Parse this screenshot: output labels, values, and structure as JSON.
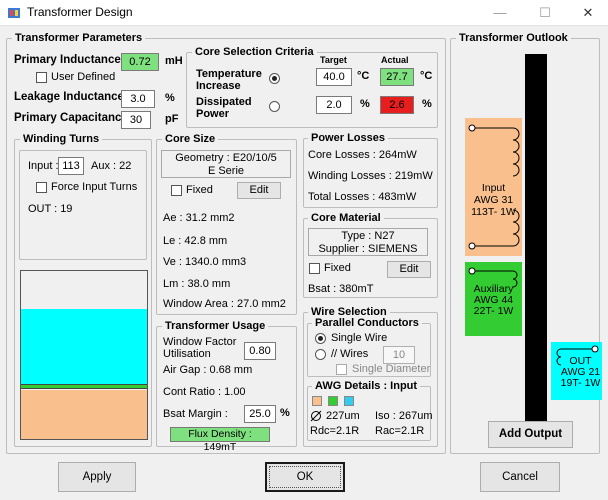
{
  "window": {
    "title": "Transformer Design",
    "min": "—",
    "max": "☐",
    "close": "✕"
  },
  "params": {
    "title": "Transformer Parameters",
    "primary_inductance_label": "Primary Inductance",
    "primary_inductance_value": "0.72",
    "primary_inductance_unit": "mH",
    "user_defined_label": "User Defined",
    "leakage_inductance_label": "Leakage Inductance",
    "leakage_inductance_value": "3.0",
    "leakage_inductance_unit": "%",
    "primary_capacitance_label": "Primary Capacitance",
    "primary_capacitance_value": "30",
    "primary_capacitance_unit": "pF"
  },
  "criteria": {
    "title": "Core Selection Criteria",
    "target_header": "Target",
    "actual_header": "Actual",
    "temp_label_1": "Temperature",
    "temp_label_2": "Increase",
    "temp_target": "40.0",
    "temp_actual": "27.7",
    "temp_unit": "°C",
    "power_label_1": "Dissipated",
    "power_label_2": "Power",
    "power_target": "2.0",
    "power_actual": "2.6",
    "power_unit": "%"
  },
  "winding": {
    "title": "Winding Turns",
    "input_label": "Input :",
    "input_value": "113",
    "aux_label": "Aux : 22",
    "force_label": "Force Input Turns",
    "out_label": "OUT : 19",
    "window_fill": {
      "cyan": "#00ffff",
      "green": "#33cc33",
      "orange": "#f9c08e"
    }
  },
  "core_size": {
    "title": "Core Size",
    "geometry_line1": "Geometry : E20/10/5",
    "geometry_line2": "E Serie",
    "fixed_label": "Fixed",
    "edit_label": "Edit",
    "ae": "Ae : 31.2 mm2",
    "le": "Le : 42.8 mm",
    "ve": "Ve : 1340.0 mm3",
    "lm": "Lm : 38.0 mm",
    "window_area": "Window Area : 27.0 mm2"
  },
  "usage": {
    "title": "Transformer Usage",
    "wfu_label_1": "Window Factor",
    "wfu_label_2": "Utilisation",
    "wfu_value": "0.80",
    "air_gap": "Air Gap : 0.68 mm",
    "cont_ratio": "Cont Ratio : 1.00",
    "bsat_margin_label": "Bsat Margin :",
    "bsat_margin_value": "25.0",
    "bsat_margin_unit": "%",
    "flux_density": "Flux Density : 149mT"
  },
  "losses": {
    "title": "Power Losses",
    "core": "Core Losses : 264mW",
    "winding": "Winding Losses : 219mW",
    "total": "Total Losses : 483mW"
  },
  "material": {
    "title": "Core Material",
    "type_line": "Type : N27",
    "supplier_line": "Supplier : SIEMENS",
    "fixed_label": "Fixed",
    "edit_label": "Edit",
    "bsat": "Bsat : 380mT"
  },
  "wire": {
    "title": "Wire Selection",
    "parallel_title": "Parallel Conductors",
    "single_wire_label": "Single Wire",
    "wires_label": "// Wires",
    "wires_value": "10",
    "single_diameter_label": "Single Diameter",
    "awg_title": "AWG Details : Input",
    "diameter": "227um",
    "iso": "Iso : 267um",
    "rdc": "Rdc=2.1R",
    "rac": "Rac=2.1R",
    "swatch_colors": [
      "#f9c08e",
      "#33cc33",
      "#33ccee"
    ]
  },
  "outlook": {
    "title": "Transformer Outlook",
    "input_winding": {
      "line1": "Input",
      "line2": "AWG 31",
      "line3": "113T- 1W"
    },
    "aux_winding": {
      "line1": "Auxiliary",
      "line2": "AWG 44",
      "line3": "22T- 1W"
    },
    "out_winding": {
      "line1": "OUT",
      "line2": "AWG 21",
      "line3": "19T- 1W"
    },
    "add_output_label": "Add Output"
  },
  "footer": {
    "apply": "Apply",
    "ok": "OK",
    "cancel": "Cancel"
  }
}
